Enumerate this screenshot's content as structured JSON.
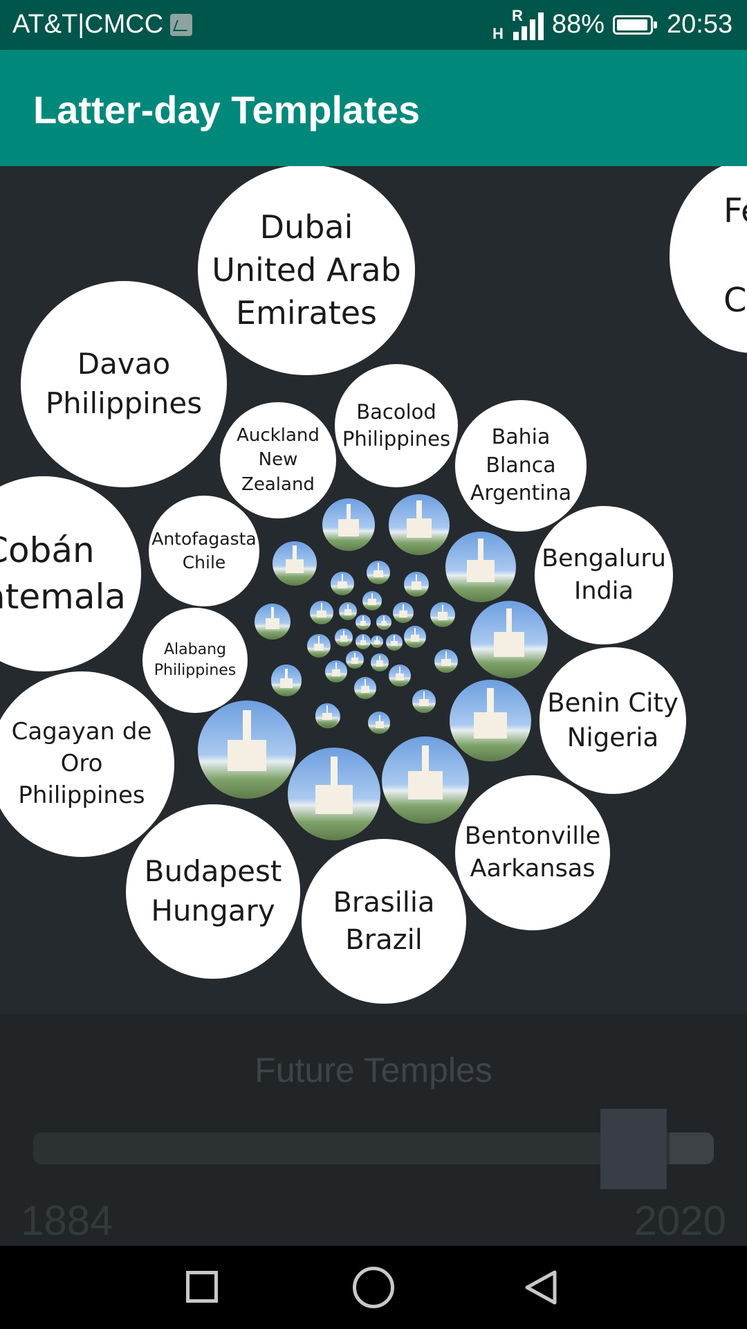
{
  "status_bar": {
    "carrier": "AT&T|CMCC",
    "network_type": "H",
    "roaming": "R",
    "battery": "88%",
    "time": "20:53"
  },
  "app_bar": {
    "title": "Latter-day Templates"
  },
  "temples": [
    {
      "label": "Dubai\nUnited Arab\nEmirates"
    },
    {
      "label": "Fe\n\nCa"
    },
    {
      "label": "Davao\nPhilippines"
    },
    {
      "label": "Auckland\nNew Zealand"
    },
    {
      "label": "Bacolod\nPhilippines"
    },
    {
      "label": "Bahia\nBlanca\nArgentina"
    },
    {
      "label": "Cobán\natemala"
    },
    {
      "label": "Antofagasta\nChile"
    },
    {
      "label": "Bengaluru\nIndia"
    },
    {
      "label": "Alabang\nPhilippines"
    },
    {
      "label": "Benin City\nNigeria"
    },
    {
      "label": "Cagayan de\nOro\nPhilippines"
    },
    {
      "label": "Bentonville\nAarkansas"
    },
    {
      "label": "Budapest\nHungary"
    },
    {
      "label": "Brasilia\nBrazil"
    }
  ],
  "controls": {
    "mode_label": "Future Temples",
    "range_min": "1884",
    "range_max": "2020",
    "slider_value_fraction": 0.92
  },
  "colors": {
    "status_bar": "#00564a",
    "app_bar": "#00897b",
    "background": "#252a2e"
  },
  "nav_icons": [
    "recent-apps-icon",
    "home-icon",
    "back-icon"
  ]
}
